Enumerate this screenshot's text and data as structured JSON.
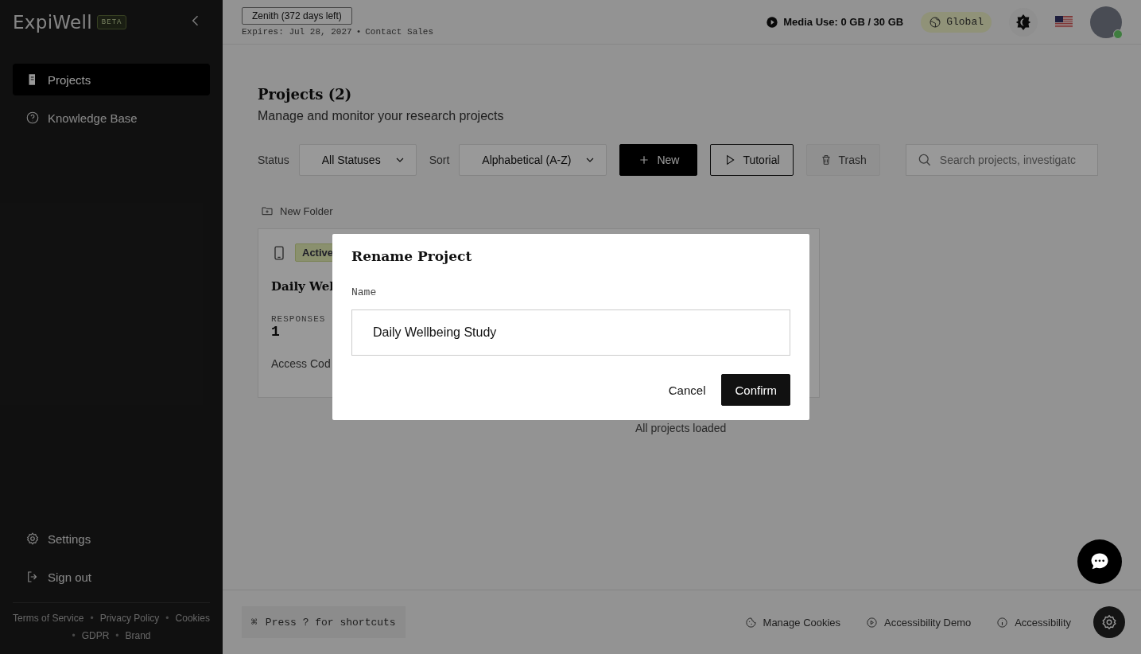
{
  "sidebar": {
    "logo": "ExpiWell",
    "badge": "BETA",
    "nav": [
      {
        "label": "Projects",
        "selected": true
      },
      {
        "label": "Knowledge Base",
        "selected": false
      }
    ],
    "bottom": [
      {
        "label": "Settings"
      },
      {
        "label": "Sign out"
      }
    ],
    "links": [
      {
        "label": "Terms of Service"
      },
      {
        "sep": "•",
        "label": "Privacy Policy"
      },
      {
        "sep": "•",
        "label": "Cookies"
      },
      {
        "sep": "•",
        "label": "GDPR"
      },
      {
        "sep": "•",
        "label": "Brand"
      }
    ]
  },
  "topbar": {
    "plan": "Zenith (372 days left)",
    "expires": "Expires: Jul 28, 2027",
    "sep": "•",
    "contact": "Contact Sales",
    "media": "Media Use: 0 GB / 30 GB",
    "region": "Global"
  },
  "page": {
    "title": "Projects (2)",
    "subtitle": "Manage and monitor your research projects",
    "filters": [
      {
        "label": "Status",
        "value": "All Statuses"
      },
      {
        "label": "Sort",
        "value": "Alphabetical (A-Z)"
      }
    ],
    "buttons": [
      {
        "label": "New",
        "kind": "primary"
      },
      {
        "label": "Tutorial",
        "kind": "outline"
      },
      {
        "label": "Trash",
        "kind": "ghost"
      }
    ],
    "search": {
      "placeholder": "Search projects, investigatc"
    },
    "new_folder": "New Folder",
    "card": {
      "status": "Active",
      "title": "Daily Wel",
      "stat_label": "RESPONSES",
      "stat_value": "1",
      "access": "Access Cod"
    },
    "loaded": "All projects loaded"
  },
  "dialog": {
    "title": "Rename Project",
    "field_label": "Name",
    "value": "Daily Wellbeing Study",
    "buttons": [
      {
        "label": "Cancel",
        "kind": "text"
      },
      {
        "label": "Confirm",
        "kind": "primary"
      }
    ]
  },
  "footer": {
    "shortcut_key": "⌘",
    "shortcut": "Press ? for shortcuts",
    "links": [
      {
        "label": "Manage Cookies"
      },
      {
        "label": "Accessibility Demo"
      },
      {
        "label": "Accessibility"
      }
    ]
  }
}
